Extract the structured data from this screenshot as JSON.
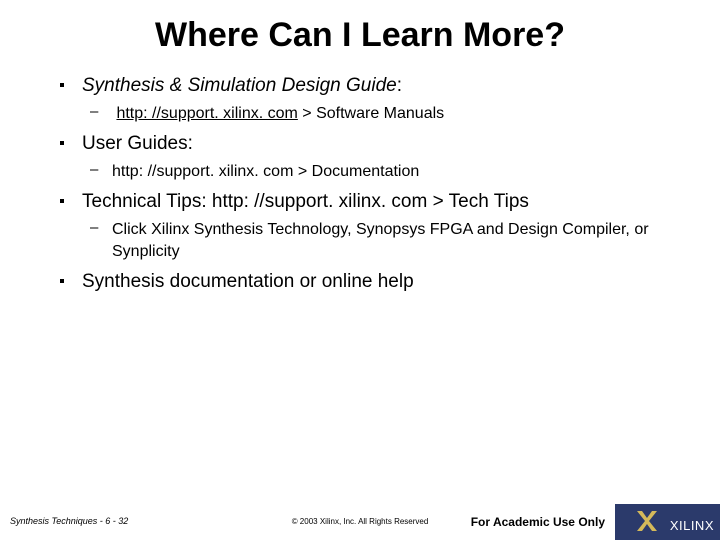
{
  "title": "Where Can I Learn More?",
  "bullets": [
    {
      "text_pre": "Synthesis & Simulation Design Guide",
      "text_post": ":",
      "italic": true,
      "subs": [
        {
          "link": "http: //support. xilinx. com",
          "after": " > Software Manuals",
          "underlined": true
        }
      ]
    },
    {
      "text_pre": "User Guides:",
      "text_post": "",
      "italic": false,
      "subs": [
        {
          "link": "",
          "after": "http: //support. xilinx. com > Documentation",
          "underlined": false
        }
      ]
    },
    {
      "text_pre": "Technical Tips: http: //support. xilinx. com > Tech Tips",
      "text_post": "",
      "italic": false,
      "subs": [
        {
          "link": "",
          "after": "Click Xilinx Synthesis Technology, Synopsys FPGA and Design Compiler, or Synplicity",
          "underlined": false
        }
      ]
    },
    {
      "text_pre": "Synthesis documentation or online help",
      "text_post": "",
      "italic": false,
      "subs": []
    }
  ],
  "footer": {
    "left": "Synthesis Techniques - 6 - 32",
    "center": "© 2003 Xilinx, Inc. All Rights Reserved",
    "right": "For Academic Use Only",
    "logo": "XILINX"
  }
}
